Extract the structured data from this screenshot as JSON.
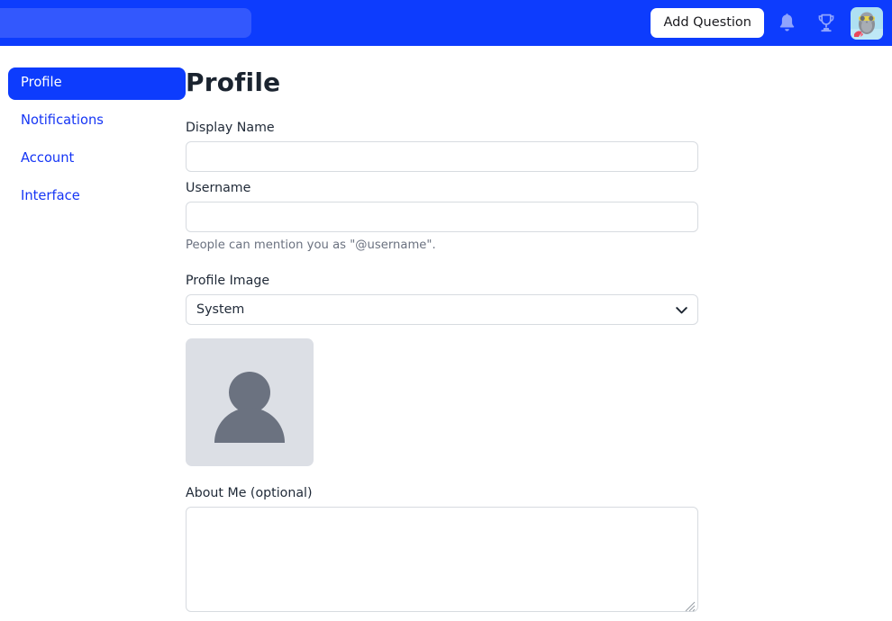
{
  "header": {
    "brand_placeholder": "",
    "add_question_label": "Add Question",
    "icons": {
      "notifications": "bell-icon",
      "achievements": "trophy-icon",
      "avatar": "user-avatar-owl"
    }
  },
  "sidebar": {
    "items": [
      {
        "label": "Profile",
        "active": true
      },
      {
        "label": "Notifications",
        "active": false
      },
      {
        "label": "Account",
        "active": false
      },
      {
        "label": "Interface",
        "active": false
      }
    ]
  },
  "main": {
    "title": "Profile",
    "display_name": {
      "label": "Display Name",
      "value": "",
      "placeholder": ""
    },
    "username": {
      "label": "Username",
      "value": "",
      "placeholder": "",
      "help": "People can mention you as \"@username\"."
    },
    "profile_image": {
      "label": "Profile Image",
      "selected": "System",
      "options": [
        "System"
      ],
      "preview_icon": "person-placeholder-icon"
    },
    "about_me": {
      "label": "About Me (optional)",
      "value": "",
      "placeholder": ""
    }
  },
  "colors": {
    "brand_blue": "#0d3cfd",
    "brand_blue_light": "#3358fd",
    "link_blue": "#1535f5",
    "icon_blue": "#8fa4fd",
    "input_border": "#d7dbe0",
    "help_text": "#6b7280",
    "avatar_bg": "#dcdfe5",
    "avatar_fg": "#6b7280"
  }
}
